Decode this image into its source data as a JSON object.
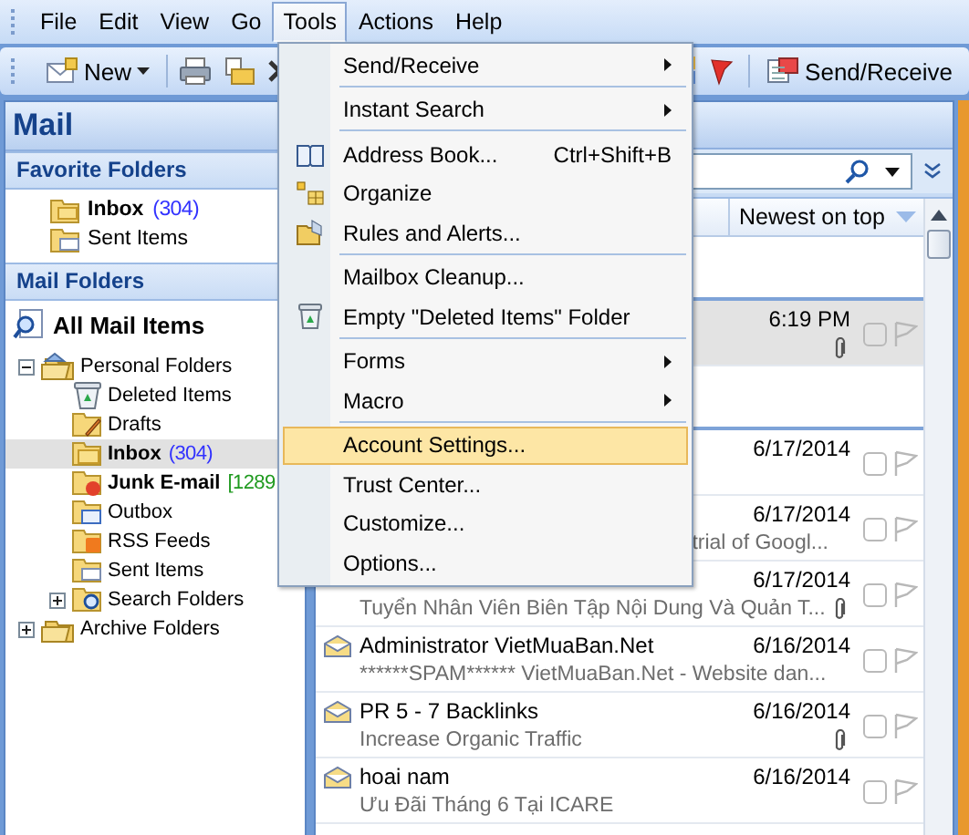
{
  "menubar": [
    {
      "label": "File",
      "selected": false
    },
    {
      "label": "Edit",
      "selected": false
    },
    {
      "label": "View",
      "selected": false
    },
    {
      "label": "Go",
      "selected": false
    },
    {
      "label": "Tools",
      "selected": true
    },
    {
      "label": "Actions",
      "selected": false
    },
    {
      "label": "Help",
      "selected": false
    }
  ],
  "toolbar": {
    "new_button": "New",
    "send_receive": "Send/Receive"
  },
  "tools_menu": [
    {
      "label": "Send/Receive",
      "submenu": true,
      "separator_after": true,
      "selected": false
    },
    {
      "label": "Instant Search",
      "submenu": true,
      "separator_after": true,
      "selected": false
    },
    {
      "label": "Address Book...",
      "shortcut": "Ctrl+Shift+B",
      "kind": "book",
      "submenu": false,
      "separator_after": false,
      "selected": false
    },
    {
      "label": "Organize",
      "kind": "organize",
      "submenu": false,
      "separator_after": false,
      "selected": false
    },
    {
      "label": "Rules and Alerts...",
      "kind": "rules",
      "submenu": false,
      "separator_after": true,
      "selected": false
    },
    {
      "label": "Mailbox Cleanup...",
      "submenu": false,
      "separator_after": false,
      "selected": false
    },
    {
      "label": "Empty \"Deleted Items\" Folder",
      "kind": "trash",
      "submenu": false,
      "separator_after": true,
      "selected": false
    },
    {
      "label": "Forms",
      "submenu": true,
      "separator_after": false,
      "selected": false
    },
    {
      "label": "Macro",
      "submenu": true,
      "separator_after": true,
      "selected": false
    },
    {
      "label": "Account Settings...",
      "submenu": false,
      "separator_after": false,
      "selected": true
    },
    {
      "label": "Trust Center...",
      "submenu": false,
      "separator_after": false,
      "selected": false
    },
    {
      "label": "Customize...",
      "submenu": false,
      "separator_after": false,
      "selected": false
    },
    {
      "label": "Options...",
      "submenu": false,
      "separator_after": false,
      "selected": false
    }
  ],
  "navigation": {
    "title": "Mail",
    "favorites_header": "Favorite Folders",
    "favorites": [
      {
        "label": "Inbox",
        "count": "(304)",
        "color": "#3232ff",
        "unread": true,
        "kind": "inbox"
      },
      {
        "label": "Sent Items",
        "unread": false,
        "kind": "sent"
      }
    ],
    "folders_header": "Mail Folders",
    "all_items": "All Mail Items",
    "tree": [
      {
        "label": "Personal Folders",
        "kind": "personal",
        "expanded": true,
        "selected": false,
        "unread": false,
        "children": [
          {
            "label": "Deleted Items",
            "kind": "trash",
            "selected": false,
            "unread": false
          },
          {
            "label": "Drafts",
            "kind": "drafts",
            "selected": false,
            "unread": false
          },
          {
            "label": "Inbox",
            "kind": "inbox",
            "count": "(304)",
            "color": "#3232ff",
            "selected": true,
            "unread": true
          },
          {
            "label": "Junk E-mail",
            "kind": "junk",
            "count": "[1289",
            "color": "#1f9a1f",
            "selected": false,
            "unread": true
          },
          {
            "label": "Outbox",
            "kind": "outbox",
            "selected": false,
            "unread": false
          },
          {
            "label": "RSS Feeds",
            "kind": "rss",
            "selected": false,
            "unread": false
          },
          {
            "label": "Sent Items",
            "kind": "sent",
            "selected": false,
            "unread": false
          },
          {
            "label": "Search Folders",
            "kind": "search",
            "expanded": false,
            "selected": false,
            "unread": false
          }
        ]
      },
      {
        "label": "Archive Folders",
        "kind": "archive",
        "expanded": false,
        "selected": false,
        "unread": false
      }
    ]
  },
  "message_list": {
    "sort": "Newest on top",
    "messages": [
      {
        "date": "6:19 PM",
        "attachment": true,
        "selected": true,
        "new_group": true
      },
      {
        "date": "6/17/2014",
        "attachment": false,
        "selected": false,
        "new_group": true
      },
      {
        "date": "6/17/2014",
        "snippet": "trial of Googl...",
        "attachment": false,
        "selected": false,
        "new_group": false
      },
      {
        "date": "6/17/2014",
        "snippet": "Tuyển Nhân Viên Biên Tập Nội Dung Và Quản T...",
        "attachment": true,
        "selected": false,
        "new_group": false
      },
      {
        "sender": "Administrator VietMuaBan.Net",
        "date": "6/16/2014",
        "snippet": "******SPAM****** VietMuaBan.Net - Website dan...",
        "attachment": false,
        "selected": false,
        "new_group": false
      },
      {
        "sender": "PR 5 - 7 Backlinks",
        "date": "6/16/2014",
        "snippet": "Increase Organic Traffic",
        "attachment": true,
        "selected": false,
        "new_group": false
      },
      {
        "sender": "hoai nam",
        "date": "6/16/2014",
        "snippet": "Ưu Đãi Tháng 6 Tại ICARE",
        "attachment": false,
        "selected": false,
        "new_group": false
      }
    ]
  }
}
